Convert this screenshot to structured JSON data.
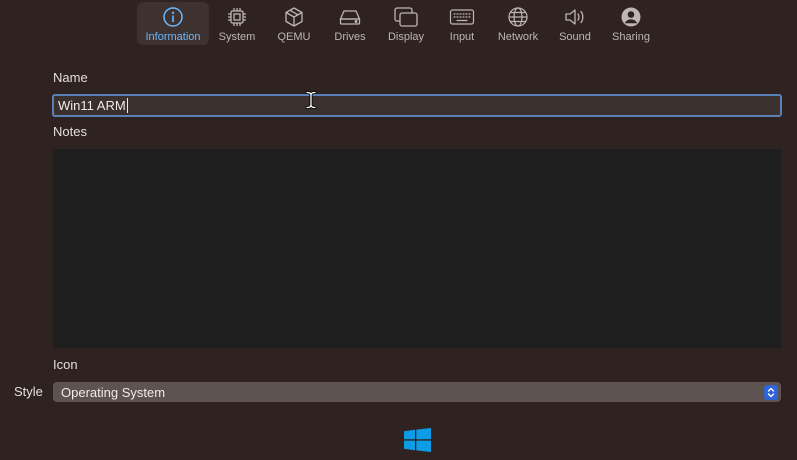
{
  "toolbar": {
    "tabs": [
      {
        "label": "Information",
        "icon": "info-icon",
        "selected": true
      },
      {
        "label": "System",
        "icon": "cpu-chip-icon"
      },
      {
        "label": "QEMU",
        "icon": "box-icon"
      },
      {
        "label": "Drives",
        "icon": "drive-icon"
      },
      {
        "label": "Display",
        "icon": "display-windows-icon"
      },
      {
        "label": "Input",
        "icon": "keyboard-icon"
      },
      {
        "label": "Network",
        "icon": "globe-icon"
      },
      {
        "label": "Sound",
        "icon": "speaker-icon"
      },
      {
        "label": "Sharing",
        "icon": "person-circle-icon"
      }
    ],
    "accent": "#6ab8ff"
  },
  "form": {
    "name_label": "Name",
    "name_value": "Win11 ARM",
    "notes_label": "Notes",
    "notes_value": "",
    "icon_label": "Icon",
    "style_label": "Style",
    "style_value": "Operating System",
    "icon_name": "windows-logo-icon"
  },
  "colors": {
    "background": "#2f2321",
    "focus_ring": "#5a80b8",
    "select_stepper": "#2f63d6",
    "windows_blue": "#0f9ce6"
  }
}
